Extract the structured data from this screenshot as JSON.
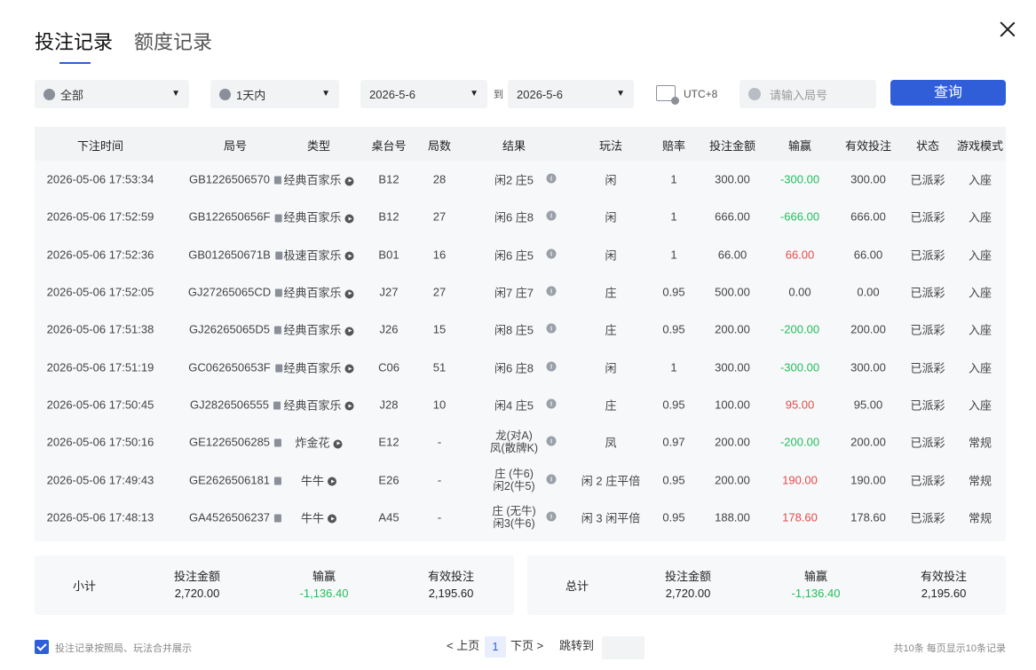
{
  "tabs": [
    {
      "label": "投注记录"
    },
    {
      "label": "额度记录"
    }
  ],
  "filters": {
    "game": "全部",
    "time_range": "1天内",
    "date_from": "2026-5-6",
    "to_label": "到",
    "date_to": "2026-5-6",
    "timezone": "UTC+8",
    "round_placeholder": "请输入局号",
    "query_label": "查询"
  },
  "table": {
    "headers": [
      "下注时间",
      "局号",
      "类型",
      "桌台号",
      "局数",
      "结果",
      "玩法",
      "赔率",
      "投注金额",
      "输赢",
      "有效投注",
      "状态",
      "游戏模式"
    ],
    "rows": [
      {
        "time": "2026-05-06 17:53:34",
        "round": "GB1226506570",
        "type": "经典百家乐",
        "table": "B12",
        "count": "28",
        "result1": "闲2 庄5",
        "result2": "",
        "play": "闲",
        "odds": "1",
        "bet": "300.00",
        "win": "-300.00",
        "win_sign": "neg",
        "valid": "300.00",
        "status": "已派彩",
        "mode": "入座"
      },
      {
        "time": "2026-05-06 17:52:59",
        "round": "GB122650656F",
        "type": "经典百家乐",
        "table": "B12",
        "count": "27",
        "result1": "闲6 庄8",
        "result2": "",
        "play": "闲",
        "odds": "1",
        "bet": "666.00",
        "win": "-666.00",
        "win_sign": "neg",
        "valid": "666.00",
        "status": "已派彩",
        "mode": "入座"
      },
      {
        "time": "2026-05-06 17:52:36",
        "round": "GB012650671B",
        "type": "极速百家乐",
        "table": "B01",
        "count": "16",
        "result1": "闲6 庄5",
        "result2": "",
        "play": "闲",
        "odds": "1",
        "bet": "66.00",
        "win": "66.00",
        "win_sign": "pos",
        "valid": "66.00",
        "status": "已派彩",
        "mode": "入座"
      },
      {
        "time": "2026-05-06 17:52:05",
        "round": "GJ27265065CD",
        "type": "经典百家乐",
        "table": "J27",
        "count": "27",
        "result1": "闲7 庄7",
        "result2": "",
        "play": "庄",
        "odds": "0.95",
        "bet": "500.00",
        "win": "0.00",
        "win_sign": "zero",
        "valid": "0.00",
        "status": "已派彩",
        "mode": "入座"
      },
      {
        "time": "2026-05-06 17:51:38",
        "round": "GJ26265065D5",
        "type": "经典百家乐",
        "table": "J26",
        "count": "15",
        "result1": "闲8 庄5",
        "result2": "",
        "play": "庄",
        "odds": "0.95",
        "bet": "200.00",
        "win": "-200.00",
        "win_sign": "neg",
        "valid": "200.00",
        "status": "已派彩",
        "mode": "入座"
      },
      {
        "time": "2026-05-06 17:51:19",
        "round": "GC062650653F",
        "type": "经典百家乐",
        "table": "C06",
        "count": "51",
        "result1": "闲6 庄8",
        "result2": "",
        "play": "闲",
        "odds": "1",
        "bet": "300.00",
        "win": "-300.00",
        "win_sign": "neg",
        "valid": "300.00",
        "status": "已派彩",
        "mode": "入座"
      },
      {
        "time": "2026-05-06 17:50:45",
        "round": "GJ2826506555",
        "type": "经典百家乐",
        "table": "J28",
        "count": "10",
        "result1": "闲4 庄5",
        "result2": "",
        "play": "庄",
        "odds": "0.95",
        "bet": "100.00",
        "win": "95.00",
        "win_sign": "pos",
        "valid": "95.00",
        "status": "已派彩",
        "mode": "入座"
      },
      {
        "time": "2026-05-06 17:50:16",
        "round": "GE1226506285",
        "type": "炸金花",
        "table": "E12",
        "count": "-",
        "result1": "龙(对A)",
        "result2": "凤(散牌K)",
        "play": "凤",
        "odds": "0.97",
        "bet": "200.00",
        "win": "-200.00",
        "win_sign": "neg",
        "valid": "200.00",
        "status": "已派彩",
        "mode": "常规"
      },
      {
        "time": "2026-05-06 17:49:43",
        "round": "GE2626506181",
        "type": "牛牛",
        "table": "E26",
        "count": "-",
        "result1": "庄 (牛6)",
        "result2": "闲2(牛5)",
        "play": "闲 2 庄平倍",
        "odds": "0.95",
        "bet": "200.00",
        "win": "190.00",
        "win_sign": "pos",
        "valid": "190.00",
        "status": "已派彩",
        "mode": "常规"
      },
      {
        "time": "2026-05-06 17:48:13",
        "round": "GA4526506237",
        "type": "牛牛",
        "table": "A45",
        "count": "-",
        "result1": "庄 (无牛)",
        "result2": "闲3(牛6)",
        "play": "闲 3 闲平倍",
        "odds": "0.95",
        "bet": "188.00",
        "win": "178.60",
        "win_sign": "pos",
        "valid": "178.60",
        "status": "已派彩",
        "mode": "常规"
      }
    ]
  },
  "subtotal": {
    "label": "小计",
    "bet_label": "投注金额",
    "bet": "2,720.00",
    "win_label": "输赢",
    "win": "-1,136.40",
    "valid_label": "有效投注",
    "valid": "2,195.60"
  },
  "total": {
    "label": "总计",
    "bet_label": "投注金额",
    "bet": "2,720.00",
    "win_label": "输赢",
    "win": "-1,136.40",
    "valid_label": "有效投注",
    "valid": "2,195.60"
  },
  "footer": {
    "merge_label": "投注记录按照局、玩法合并展示",
    "prev": "< 上页",
    "page": "1",
    "next": "下页 >",
    "jump": "跳转到",
    "total_text": "共10条  每页显示10条记录"
  },
  "colors": {
    "accent": "#2f5ed8",
    "negative": "#1fbf5a",
    "positive": "#e24b4b"
  }
}
